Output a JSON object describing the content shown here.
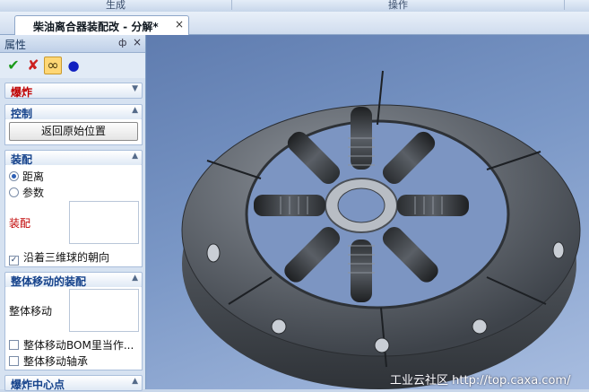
{
  "ribbon": {
    "group1": "生成",
    "group2": "操作"
  },
  "document_tab": {
    "title": "柴油离合器装配改 - 分解*",
    "close": "×"
  },
  "panel": {
    "title": "属性",
    "pin": "ф",
    "close": "×",
    "toolbar": {
      "ok": "✔",
      "cancel": "✘",
      "preview": "∞",
      "dot": "●"
    },
    "sections": {
      "explode": {
        "title": "爆炸",
        "chevron": "▼"
      },
      "control": {
        "title": "控制",
        "chevron": "▲",
        "reset_button": "返回原始位置"
      },
      "assembly": {
        "title": "装配",
        "chevron": "▲",
        "radio_distance": "距离",
        "radio_param": "参数",
        "field_label": "装配",
        "along_3d_ball": "沿着三维球的朝向",
        "along_checked": true
      },
      "whole_move_assembly": {
        "title": "整体移动的装配",
        "chevron": "▲",
        "field_label": "整体移动",
        "bom_check": "整体移动BOM里当作...",
        "bearing_check": "整体移动轴承"
      },
      "explode_center": {
        "title": "爆炸中心点",
        "chevron": "▲"
      }
    }
  },
  "viewport": {
    "watermark": "工业云社区 http://top.caxa.com/"
  },
  "colors": {
    "accent": "#15428b",
    "explode_title": "#c00000",
    "viewport_bg": "#7a97c6"
  }
}
